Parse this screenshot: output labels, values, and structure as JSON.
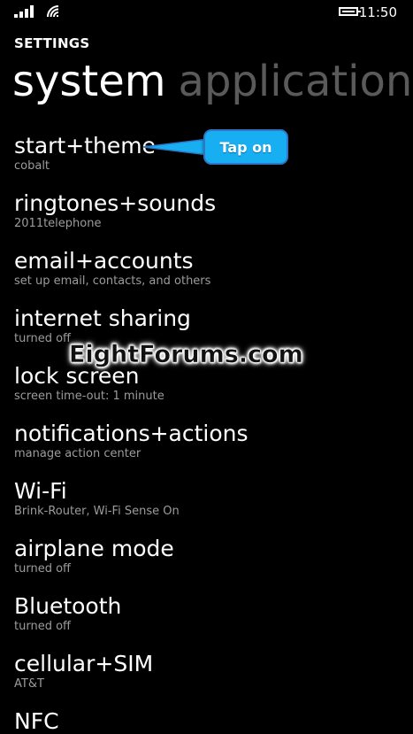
{
  "status_bar": {
    "time": "11:50",
    "signal_icon": "signal-bars-icon",
    "wifi_icon": "wifi-icon",
    "battery_icon": "battery-icon"
  },
  "header": {
    "title": "SETTINGS",
    "tabs": [
      {
        "label": "system",
        "active": true
      },
      {
        "label": "applications",
        "active": false
      }
    ]
  },
  "items": [
    {
      "title": "start+theme",
      "subtitle": "cobalt"
    },
    {
      "title": "ringtones+sounds",
      "subtitle": "2011telephone"
    },
    {
      "title": "email+accounts",
      "subtitle": "set up email, contacts, and others"
    },
    {
      "title": "internet sharing",
      "subtitle": "turned off"
    },
    {
      "title": "lock screen",
      "subtitle": "screen time-out: 1 minute"
    },
    {
      "title": "notifications+actions",
      "subtitle": "manage action center"
    },
    {
      "title": "Wi-Fi",
      "subtitle": "Brink-Router, Wi-Fi Sense On"
    },
    {
      "title": "airplane mode",
      "subtitle": "turned off"
    },
    {
      "title": "Bluetooth",
      "subtitle": "turned off"
    },
    {
      "title": "cellular+SIM",
      "subtitle": "AT&T"
    },
    {
      "title": "NFC",
      "subtitle": ""
    }
  ],
  "callout": {
    "label": "Tap on",
    "color": "#17aef2"
  },
  "watermark": {
    "text": "EightForums.com"
  }
}
